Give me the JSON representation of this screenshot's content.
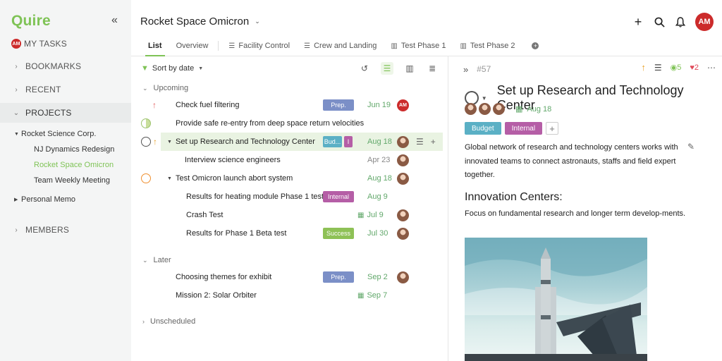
{
  "sidebar": {
    "logo": "Quire",
    "collapse_icon": "double-chevron-left-icon",
    "my_tasks": {
      "avatar": "AM",
      "label": "MY TASKS"
    },
    "sections": [
      {
        "label": "BOOKMARKS"
      },
      {
        "label": "RECENT"
      },
      {
        "label": "PROJECTS"
      },
      {
        "label": "MEMBERS"
      }
    ],
    "projects": [
      {
        "label": "Rocket Science Corp."
      },
      {
        "label": "NJ Dynamics Redesign"
      },
      {
        "label": "Rocket Space Omicron"
      },
      {
        "label": "Team Weekly Meeting"
      },
      {
        "label": "Personal Memo"
      }
    ]
  },
  "header": {
    "project_title": "Rocket Space Omicron",
    "avatar": "AM",
    "tabs": [
      {
        "label": "List"
      },
      {
        "label": "Overview"
      },
      {
        "label": "Facility Control"
      },
      {
        "label": "Crew and Landing"
      },
      {
        "label": "Test Phase 1"
      },
      {
        "label": "Test Phase 2"
      }
    ]
  },
  "list": {
    "sort_label": "Sort by date",
    "groups": {
      "upcoming": "Upcoming",
      "later": "Later",
      "unscheduled": "Unscheduled"
    },
    "tasks": [
      {
        "name": "Check fuel filtering",
        "tag": "Prep.",
        "date": "Jun 19",
        "avatar": "AM"
      },
      {
        "name": "Provide safe re-entry from deep space return velocities"
      },
      {
        "name": "Set up Research and Technology Center",
        "tag": "Bud...",
        "tag2": "I",
        "date": "Aug 18"
      },
      {
        "name": "Interview science engineers",
        "date": "Apr 23"
      },
      {
        "name": "Test Omicron launch abort system",
        "date": "Aug 18"
      },
      {
        "name": "Results for heating module Phase 1 test",
        "tag": "Internal",
        "date": "Aug 9"
      },
      {
        "name": "Crash Test",
        "date": "Jul 9"
      },
      {
        "name": "Results for Phase 1 Beta test",
        "tag": "Success",
        "date": "Jul 30"
      },
      {
        "name": "Choosing themes for exhibit",
        "tag": "Prep.",
        "date": "Sep 2"
      },
      {
        "name": "Mission 2: Solar Orbiter",
        "date": "Sep 7"
      }
    ]
  },
  "detail": {
    "task_id": "#57",
    "views": "5",
    "likes": "2",
    "title": "Set up Research and Technology Center",
    "due": "Aug 18",
    "tags": [
      "Budget",
      "Internal"
    ],
    "description": "Global network of research and technology centers works with innovated teams to connect astronauts, staffs and field expert together.",
    "heading": "Innovation Centers:",
    "paragraph": "Focus on fundamental research and longer term develop-ments."
  },
  "colors": {
    "brand_green": "#7fc356",
    "date_green": "#62a86b",
    "tag_prep": "#7b8fc7",
    "tag_budget": "#5bb0c5",
    "tag_internal": "#b55ea6",
    "tag_success": "#8ec156",
    "avatar_red": "#cc2b2b"
  }
}
